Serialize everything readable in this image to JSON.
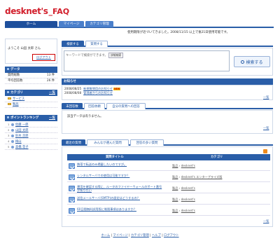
{
  "logo": {
    "part1": "desknet's",
    "part2": "_FAQ"
  },
  "nav": {
    "tabs": [
      "ホーム",
      "マイページ",
      "カテゴリ管理"
    ]
  },
  "notice": "使用期限が近づいてきました。2008/11/15 以上で後21日使用可能です。",
  "welcome": {
    "text": "ようこそ 山田 太郎 さん",
    "logout": "ログアウト"
  },
  "data_section": {
    "title": "データ",
    "rows": [
      {
        "label": "質問総数",
        "value": "13 件"
      },
      {
        "label": "平均回答数",
        "value": "26 件"
      }
    ]
  },
  "category_section": {
    "title": "カテゴリ",
    "more": "一覧",
    "items": [
      "サービス",
      "製品"
    ]
  },
  "ranking_section": {
    "title": "ポイントランキング",
    "more": "一覧",
    "items": [
      {
        "rank": "1",
        "name": "佐藤 一郎"
      },
      {
        "rank": "2",
        "name": "山田 太郎"
      },
      {
        "rank": "3",
        "name": "鈴木 次郎"
      },
      {
        "rank": "4",
        "name": "梅山"
      },
      {
        "rank": "5",
        "name": "高橋 花子"
      }
    ]
  },
  "search": {
    "tabs": [
      "検索する",
      "質問する"
    ],
    "placeholder": "キーワードで検索ができます。",
    "detail_label": "詳細検索",
    "button": "検索する"
  },
  "news": {
    "title": "お知らせ",
    "more": "一覧",
    "items": [
      {
        "date": "2008/08/25",
        "text": "新規質問用のお知らせ",
        "badge": "NEW"
      },
      {
        "date": "2008/08/08",
        "text": "管理者からのお知らせ",
        "badge": ""
      }
    ]
  },
  "answers": {
    "tabs": [
      "未回答数",
      "回答依頼",
      "自分の質問への回答"
    ],
    "empty": "該当データは有りません。",
    "more": "一覧"
  },
  "latest": {
    "tabs": [
      "最近の質問",
      "みんなが選んだ質問",
      "回答の多い質問"
    ],
    "columns": [
      "質問タイトル",
      "カテゴリ"
    ],
    "rows": [
      {
        "title": "携帯で転送のみ掲載したいのですが。",
        "cat1": "製品",
        "cat2": "desknet's"
      },
      {
        "title": "レンタルサーバでの使用は可能ですか？",
        "cat1": "製品",
        "cat2": "desknet's エンタープライズ版"
      },
      {
        "title": "運用を確認する際に、ルータのファイヤーウォールのポート番号が知りたい",
        "cat1": "製品",
        "cat2": "desknet's"
      },
      {
        "title": "送信メールサーバ(SMTP)の設定はどうするの？",
        "cat1": "製品",
        "cat2": "desknet's"
      },
      {
        "title": "60日間無料試用版に制限事項はありますか？",
        "cat1": "製品",
        "cat2": "desknet's"
      }
    ],
    "more": "一覧"
  },
  "footer": {
    "links": [
      "ホーム",
      "マイページ",
      "カテゴリ管理",
      "ヘルプ",
      "ログアウト"
    ]
  }
}
